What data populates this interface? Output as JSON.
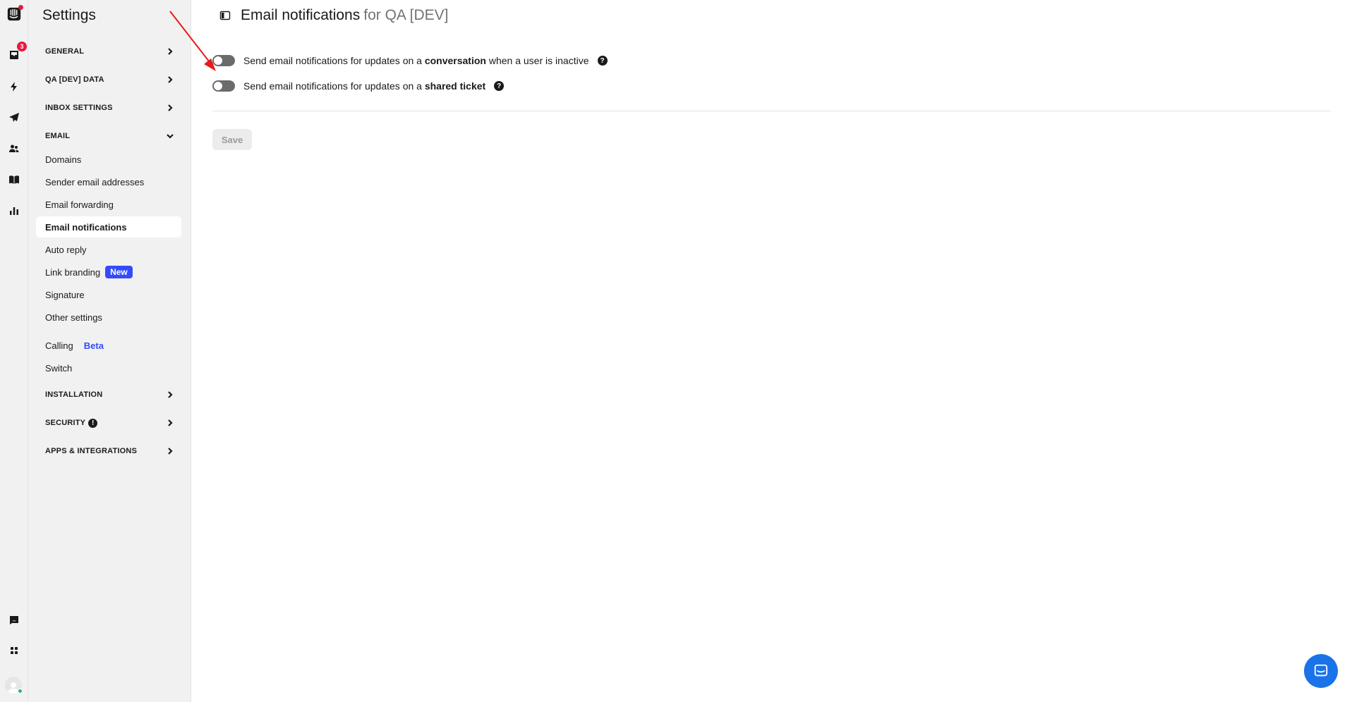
{
  "rail": {
    "icons": [
      "intercom-logo-icon",
      "inbox-icon",
      "lightning-icon",
      "send-icon",
      "contacts-icon",
      "book-icon",
      "reports-icon",
      "chat-icon",
      "apps-grid-icon",
      "user-avatar"
    ],
    "inbox_badge": "3"
  },
  "sidebar": {
    "title": "Settings",
    "sections": {
      "general": "GENERAL",
      "qa_data": "QA [DEV] DATA",
      "inbox_settings": "INBOX SETTINGS",
      "email": "EMAIL",
      "installation": "INSTALLATION",
      "security": "SECURITY",
      "apps": "APPS & INTEGRATIONS"
    },
    "email_items": [
      "Domains",
      "Sender email addresses",
      "Email forwarding",
      "Email notifications",
      "Auto reply",
      "Link branding",
      "Signature",
      "Other settings"
    ],
    "new_badge": "New",
    "calling": "Calling",
    "beta_badge": "Beta",
    "switch": "Switch",
    "security_alert": "!"
  },
  "header": {
    "title": "Email notifications",
    "subtitle": "for QA [DEV]"
  },
  "options": [
    {
      "prefix": "Send email notifications for updates on a ",
      "bold": "conversation",
      "suffix": " when a user is inactive",
      "enabled": false
    },
    {
      "prefix": "Send email notifications for updates on a ",
      "bold": "shared ticket",
      "suffix": "",
      "enabled": false
    }
  ],
  "help_glyph": "?",
  "save_label": "Save",
  "colors": {
    "accent": "#334bfa",
    "badge_red": "#e5193f",
    "toggle_off": "#6b6b6b",
    "messenger": "#1a73e8",
    "annotation_arrow": "#e8191c"
  }
}
